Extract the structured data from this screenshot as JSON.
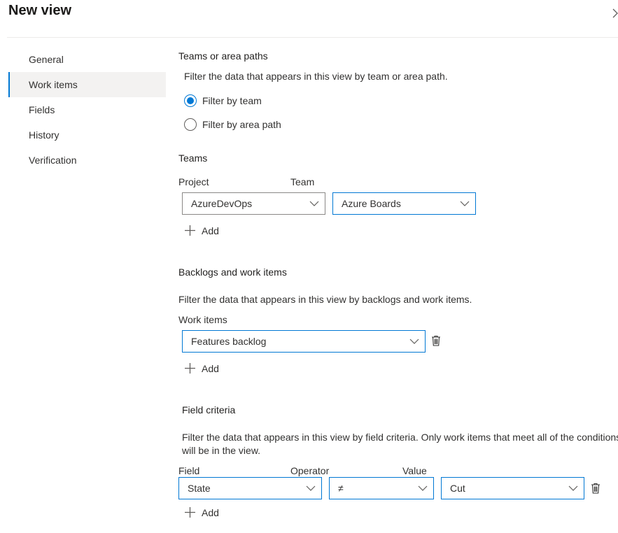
{
  "header": {
    "title": "New view"
  },
  "nav": {
    "items": [
      {
        "label": "General"
      },
      {
        "label": "Work items"
      },
      {
        "label": "Fields"
      },
      {
        "label": "History"
      },
      {
        "label": "Verification"
      }
    ],
    "selected": "Work items"
  },
  "teams_or_area": {
    "title": "Teams or area paths",
    "description": "Filter the data that appears in this view by team or area path.",
    "options": [
      {
        "label": "Filter by team",
        "checked": true
      },
      {
        "label": "Filter by area path",
        "checked": false
      }
    ]
  },
  "teams": {
    "title": "Teams",
    "project_label": "Project",
    "team_label": "Team",
    "project_value": "AzureDevOps",
    "team_value": "Azure Boards",
    "add_label": "Add"
  },
  "backlogs": {
    "title": "Backlogs and work items",
    "description": "Filter the data that appears in this view by backlogs and work items.",
    "work_items_label": "Work items",
    "work_items_value": "Features backlog",
    "add_label": "Add"
  },
  "field_criteria": {
    "title": "Field criteria",
    "description": "Filter the data that appears in this view by field criteria. Only work items that meet all of the conditions will be in the view.",
    "field_label": "Field",
    "operator_label": "Operator",
    "value_label": "Value",
    "field_value": "State",
    "operator_value": "≠",
    "value_value": "Cut",
    "add_label": "Add"
  },
  "colors": {
    "accent": "#0078d4",
    "border": "#8a8886",
    "nav_selected_bg": "#f3f2f1"
  }
}
